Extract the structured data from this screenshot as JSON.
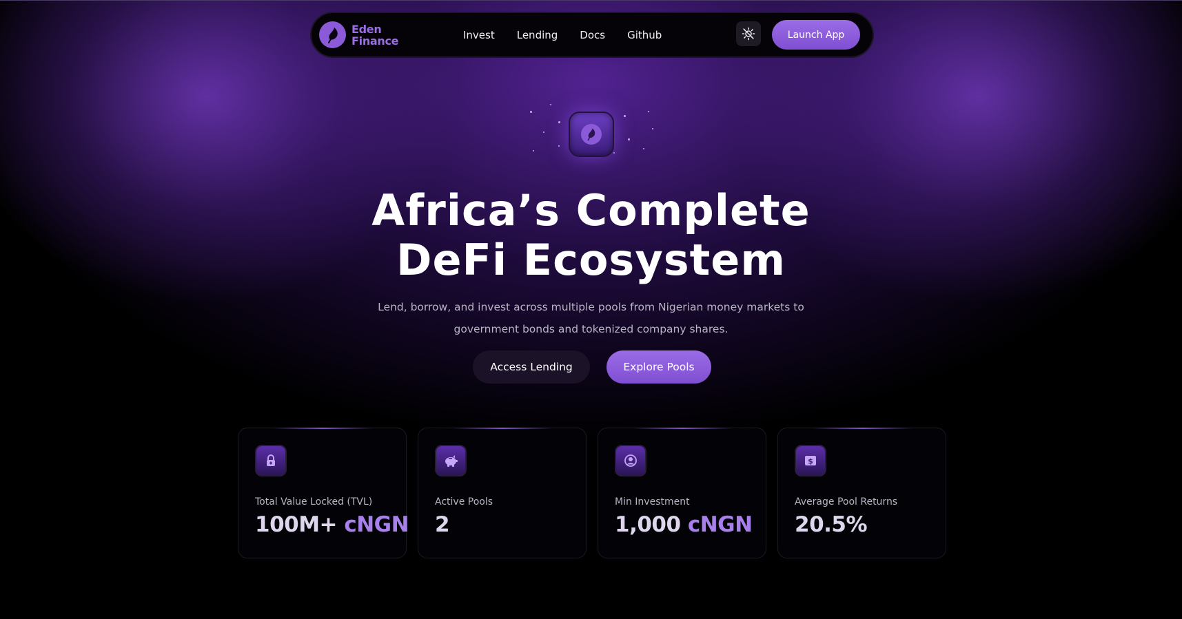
{
  "nav": {
    "brand_line1": "Eden",
    "brand_line2": "Finance",
    "links": [
      "Invest",
      "Lending",
      "Docs",
      "Github"
    ],
    "theme_icon": "sun-icon",
    "launch_label": "Launch App"
  },
  "hero": {
    "icon": "leaf-icon",
    "title_line1": "Africa’s Complete",
    "title_line2": "DeFi Ecosystem",
    "subtitle_line1": "Lend, borrow, and invest across multiple pools from Nigerian money markets to",
    "subtitle_line2": "government bonds and tokenized company shares.",
    "btn_secondary": "Access Lending",
    "btn_primary": "Explore Pools"
  },
  "stats": [
    {
      "icon": "lock-icon",
      "label": "Total Value Locked (TVL)",
      "value": "100M+",
      "unit": "cNGN"
    },
    {
      "icon": "piggy-bank-icon",
      "label": "Active Pools",
      "value": "2",
      "unit": ""
    },
    {
      "icon": "user-circle-icon",
      "label": "Min Investment",
      "value": "1,000",
      "unit": "cNGN"
    },
    {
      "icon": "dollar-icon",
      "label": "Average Pool Returns",
      "value": "20.5%",
      "unit": ""
    }
  ],
  "colors": {
    "accent": "#8a5ad8",
    "accent_light": "#a880ec",
    "background": "#000000",
    "muted_text": "#b9b4c4"
  }
}
